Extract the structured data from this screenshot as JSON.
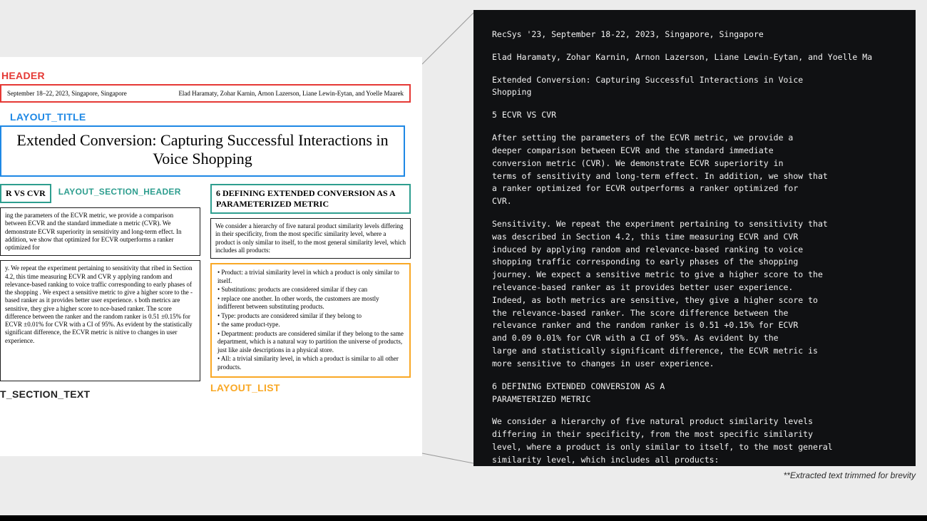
{
  "labels": {
    "header": "HEADER",
    "layout_title": "LAYOUT_TITLE",
    "layout_section_header": "LAYOUT_SECTION_HEADER",
    "layout_section_text": "T_SECTION_TEXT",
    "layout_list": "LAYOUT_LIST"
  },
  "page": {
    "header": {
      "left": "September 18–22, 2023, Singapore, Singapore",
      "right": "Elad Haramaty, Zohar Karnin, Arnon Lazerson, Liane Lewin-Eytan, and Yoelle Maarek"
    },
    "title": "Extended Conversion: Capturing Successful Interactions in Voice Shopping",
    "left": {
      "sec_header": "R VS CVR",
      "para1": "ing the parameters of the ECVR metric, we provide a comparison between ECVR and the standard immediate n metric (CVR). We demonstrate ECVR superiority in sensitivity and long-term effect. In addition, we show that optimized for ECVR outperforms a ranker optimized for",
      "para2": "y. We repeat the experiment pertaining to sensitivity that ribed in Section 4.2, this time measuring ECVR and CVR y applying random and relevance-based ranking to voice traffic corresponding to early phases of the shopping . We expect a sensitive metric to give a higher score to the -based ranker as it provides better user experience. s both metrics are sensitive, they give a higher score to nce-based ranker. The score difference between the ranker and the random ranker is 0.51 ±0.15% for ECVR ±0.01% for CVR with a CI of 95%. As evident by the statistically significant difference, the ECVR metric is nitive to changes in user experience."
    },
    "right": {
      "sec_header": "6 DEFINING EXTENDED CONVERSION AS A PARAMETERIZED METRIC",
      "intro": "We consider a hierarchy of five natural product similarity levels differing in their specificity, from the most specific similarity level, where a product is only similar to itself, to the most general similarity level, which includes all products:",
      "list": [
        "• Product: a trivial similarity level in which a product is only similar to itself.",
        "• Substitutions: products are considered similar if they can",
        "• replace one another. In other words, the customers are mostly indifferent between substituting products.",
        "• Type: products are considered similar if they belong to",
        "• the same product-type.",
        "• Department: products are considered similar if they belong to the same department, which is a natural way to partition the universe of products, just like aisle descriptions in a physical store.",
        "• All: a trivial similarity level, in which a product is similar to all other products."
      ]
    }
  },
  "extracted": {
    "l1": "RecSys '23, September 18-22, 2023, Singapore, Singapore",
    "l2": "Elad Haramaty, Zohar Karnin, Arnon Lazerson, Liane Lewin-Eytan, and Yoelle Ma",
    "l3": "Extended Conversion: Capturing Successful Interactions in Voice\nShopping",
    "l4": "5 ECVR VS CVR",
    "l5": "After setting the parameters of the ECVR metric, we provide a\ndeeper comparison between ECVR and the standard immediate\nconversion metric (CVR). We demonstrate ECVR superiority in\nterms of sensitivity and long-term effect. In addition, we show that\na ranker optimized for ECVR outperforms a ranker optimized for\nCVR.",
    "l6": "Sensitivity. We repeat the experiment pertaining to sensitivity that\nwas described in Section 4.2, this time measuring ECVR and CVR\ninduced by applying random and relevance-based ranking to voice\nshopping traffic corresponding to early phases of the shopping\njourney. We expect a sensitive metric to give a higher score to the\nrelevance-based ranker as it provides better user experience.\nIndeed, as both metrics are sensitive, they give a higher score to\nthe relevance-based ranker. The score difference between the\nrelevance ranker and the random ranker is 0.51 +0.15% for ECVR\nand 0.09 0.01% for CVR with a CI of 95%. As evident by the\nlarge and statistically significant difference, the ECVR metric is\nmore sensitive to changes in user experience.",
    "l7": "6 DEFINING EXTENDED CONVERSION AS A\nPARAMETERIZED METRIC",
    "l8": "We consider a hierarchy of five natural product similarity levels\ndiffering in their specificity, from the most specific similarity\nlevel, where a product is only similar to itself, to the most general\nsimilarity level, which includes all products:",
    "l9": "....."
  },
  "caption": "**Extracted text trimmed for brevity"
}
